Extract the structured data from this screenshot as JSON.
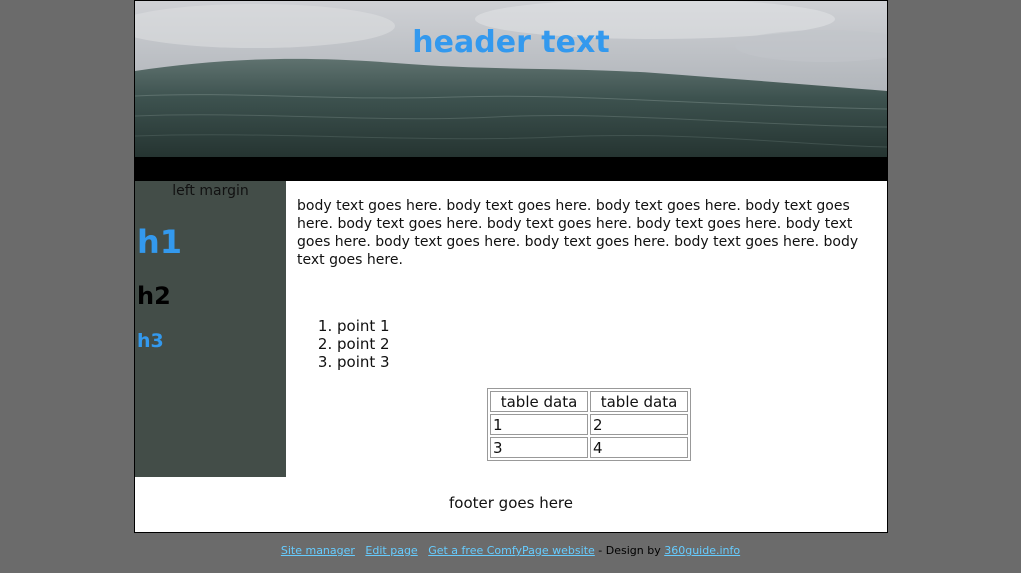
{
  "header": {
    "title": "header text"
  },
  "left_margin": {
    "label": "left margin",
    "h1": "h1",
    "h2": "h2",
    "h3": "h3"
  },
  "main": {
    "body_text": "body text goes here.  body text goes here.  body text goes here.  body text goes here.  body text goes here.  body text goes here.  body text goes here.  body text goes here.  body text goes here.  body text goes here.  body text goes here.  body text goes here.",
    "points": [
      "point 1",
      "point 2",
      "point 3"
    ],
    "table": {
      "headers": [
        "table data",
        "table data"
      ],
      "rows": [
        [
          "1",
          "2"
        ],
        [
          "3",
          "4"
        ]
      ]
    }
  },
  "footer": {
    "text": "footer goes here"
  },
  "bottom_links": {
    "site_manager": "Site manager",
    "edit_page": "Edit page",
    "free_site": "Get a free ComfyPage website",
    "design_by": " - Design by ",
    "designer": "360guide.info"
  },
  "colors": {
    "page_background": "#6b6b6b",
    "accent_blue": "#3399ee",
    "left_margin_bg": "#434d48",
    "link_color": "#66ccff"
  }
}
